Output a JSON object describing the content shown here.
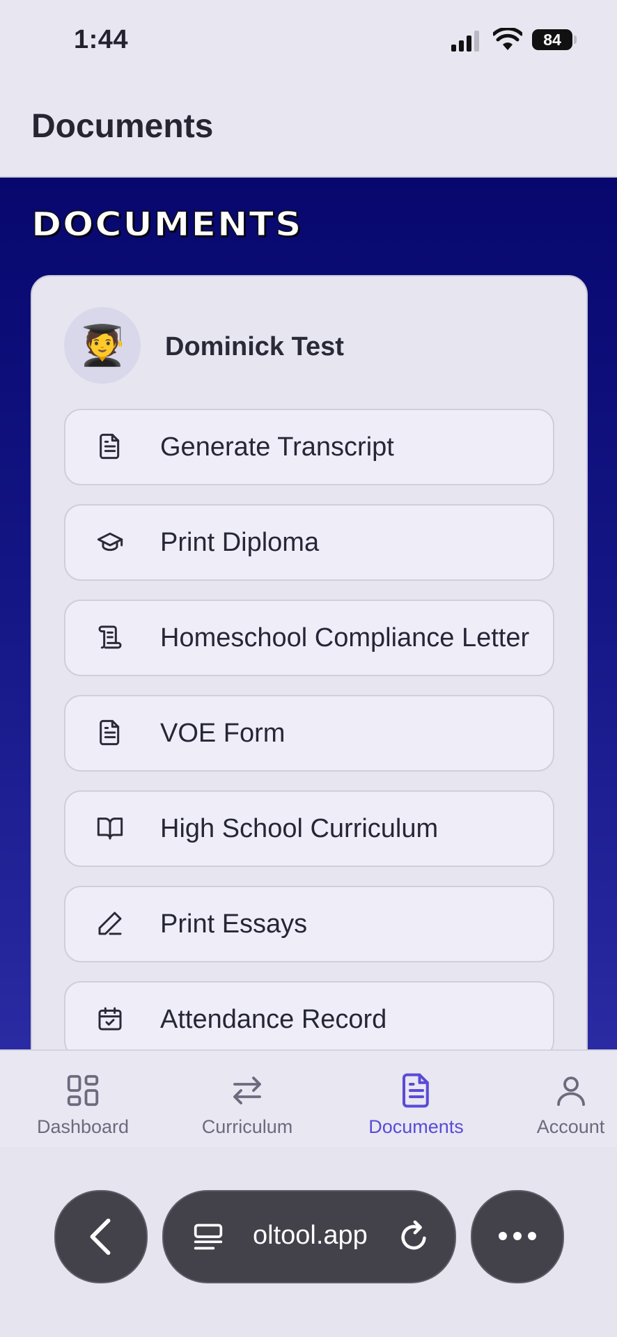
{
  "status_bar": {
    "time": "1:44",
    "battery": "84"
  },
  "header": {
    "title": "Documents"
  },
  "hero": {
    "title": "DOCUMENTS"
  },
  "student": {
    "avatar": "🧑‍🎓",
    "name": "Dominick Test"
  },
  "documents": [
    {
      "label": "Generate Transcript",
      "icon": "document-text-icon"
    },
    {
      "label": "Print Diploma",
      "icon": "graduation-cap-icon"
    },
    {
      "label": "Homeschool Compliance Letter",
      "icon": "scroll-icon"
    },
    {
      "label": "VOE Form",
      "icon": "document-text-icon"
    },
    {
      "label": "High School Curriculum",
      "icon": "open-book-icon"
    },
    {
      "label": "Print Essays",
      "icon": "pen-icon"
    },
    {
      "label": "Attendance Record",
      "icon": "calendar-check-icon"
    }
  ],
  "tabs": [
    {
      "label": "Dashboard",
      "icon": "grid-icon",
      "active": false
    },
    {
      "label": "Curriculum",
      "icon": "arrows-exchange-icon",
      "active": false
    },
    {
      "label": "Documents",
      "icon": "document-text-icon",
      "active": true
    },
    {
      "label": "Account",
      "icon": "user-icon",
      "active": false
    }
  ],
  "browser": {
    "url": "oltool.app"
  },
  "colors": {
    "accent": "#5a4bd6",
    "hero_top": "#07076e",
    "hero_bottom": "#2a2aa2",
    "tab_inactive": "#6c6a7d"
  }
}
